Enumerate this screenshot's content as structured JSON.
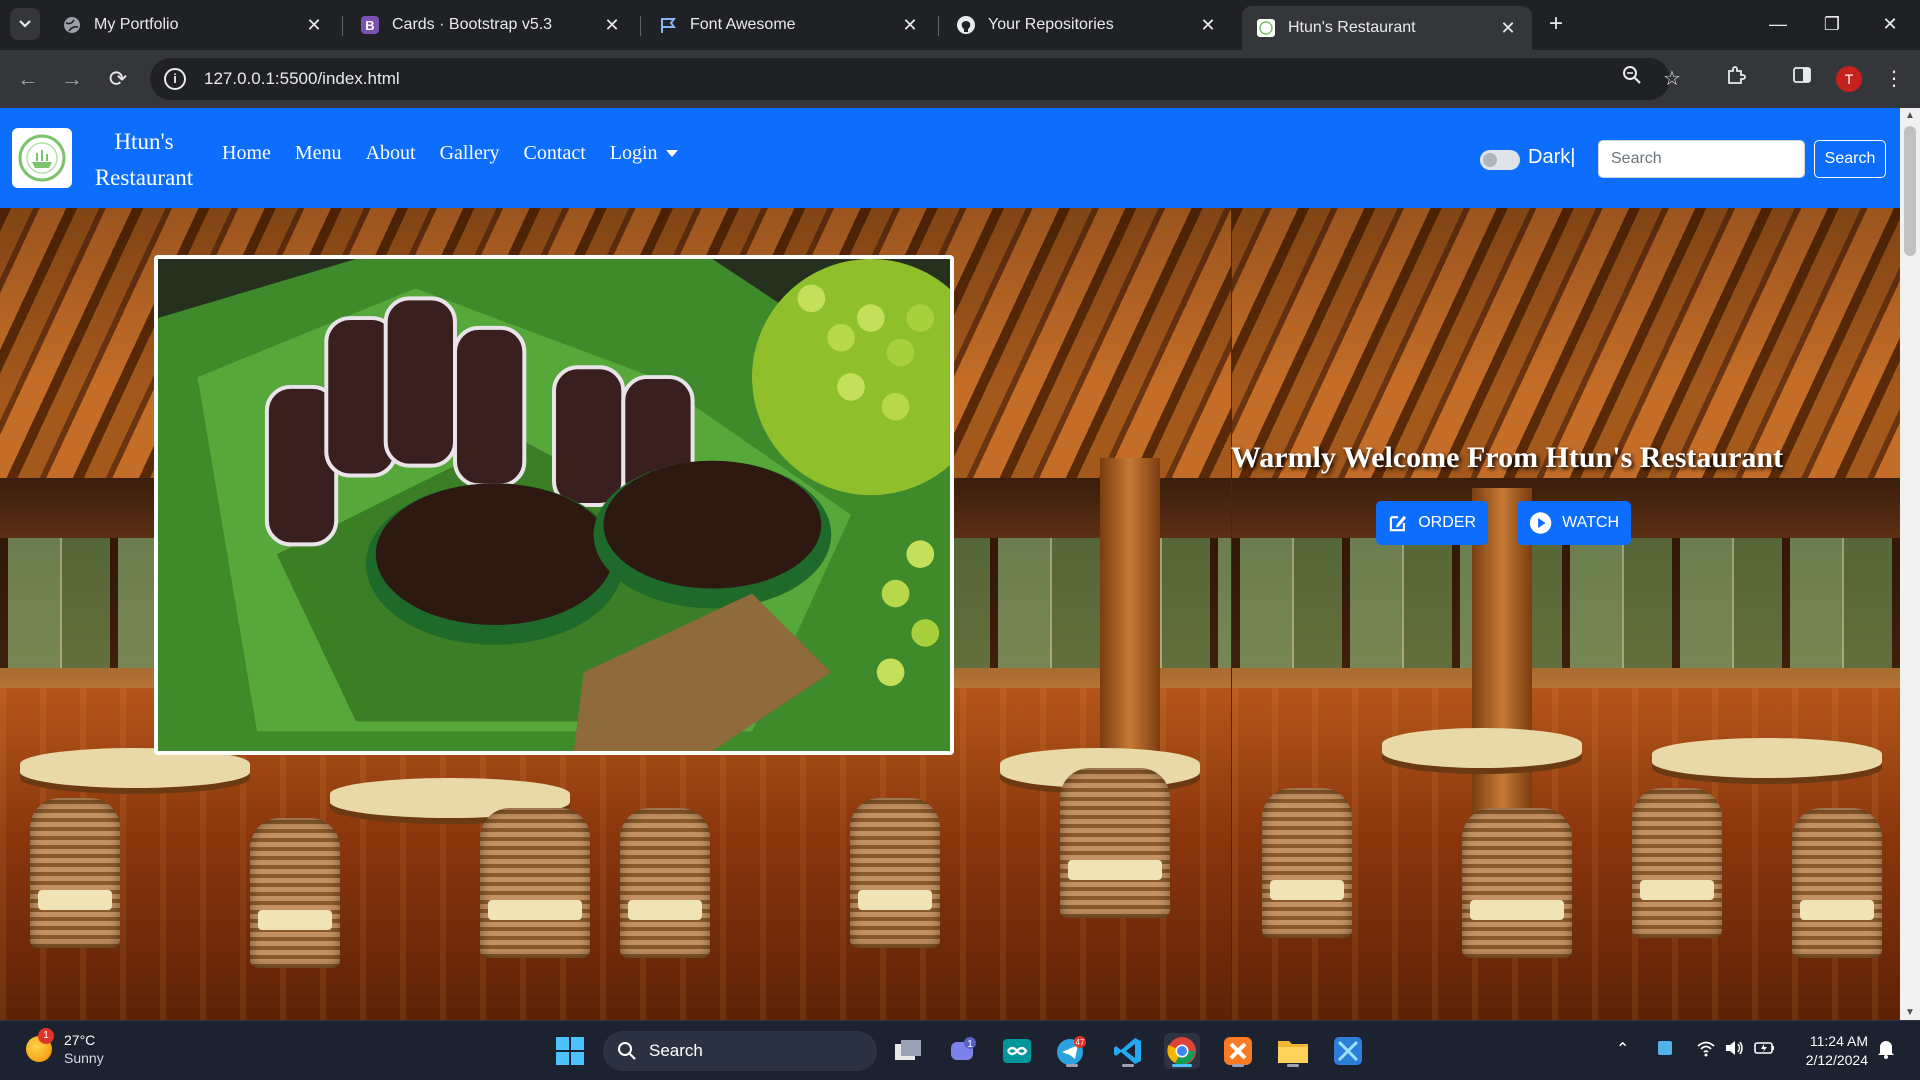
{
  "browser": {
    "tabs": [
      {
        "title": "My Portfolio",
        "icon": "globe-icon"
      },
      {
        "title": "Cards · Bootstrap v5.3",
        "icon": "bootstrap-icon"
      },
      {
        "title": "Font Awesome",
        "icon": "flag-icon"
      },
      {
        "title": "Your Repositories",
        "icon": "github-icon"
      },
      {
        "title": "Htun's Restaurant",
        "icon": "site-favicon-icon",
        "active": true
      }
    ],
    "url": "127.0.0.1:5500/index.html",
    "profile_initial": "T"
  },
  "site": {
    "brand_line1": "Htun's",
    "brand_line2": "Restaurant",
    "nav": [
      "Home",
      "Menu",
      "About",
      "Gallery",
      "Contact",
      "Login"
    ],
    "dark_label": "Dark|",
    "search_placeholder": "Search",
    "search_button": "Search",
    "hero": {
      "welcome": "Warmly Welcome From Htun's Restaurant",
      "order_label": "ORDER",
      "watch_label": "WATCH"
    },
    "colors": {
      "primary": "#0d6efd"
    }
  },
  "taskbar": {
    "weather_temp": "27°C",
    "weather_desc": "Sunny",
    "weather_badge": "1",
    "search_label": "Search",
    "teams_badge": "1",
    "telegram_badge": "47",
    "time": "11:24 AM",
    "date": "2/12/2024"
  }
}
